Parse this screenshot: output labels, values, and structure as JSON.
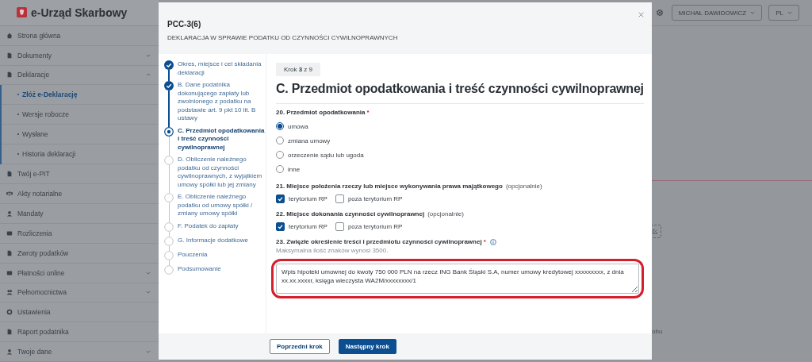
{
  "header": {
    "logo_text": "e-Urząd Skarbowy",
    "user_menu": "MICHAŁ DAWIDOWICZ",
    "language": "PL"
  },
  "sidebar": {
    "items": [
      {
        "label": "Strona główna"
      },
      {
        "label": "Dokumenty",
        "expanded": false
      },
      {
        "label": "Deklaracje",
        "expanded": true,
        "children": [
          {
            "label": "Złóż e-Deklarację",
            "selected": true
          },
          {
            "label": "Wersje robocze",
            "selected": false
          },
          {
            "label": "Wysłane",
            "selected": false
          },
          {
            "label": "Historia deklaracji",
            "selected": false
          }
        ]
      },
      {
        "label": "Twój e-PIT"
      },
      {
        "label": "Akty notarialne"
      },
      {
        "label": "Mandaty"
      },
      {
        "label": "Rozliczenia"
      },
      {
        "label": "Zwroty podatków"
      },
      {
        "label": "Płatności online",
        "expanded": false
      },
      {
        "label": "Pełnomocnictwa",
        "expanded": false
      },
      {
        "label": "Ustawienia"
      },
      {
        "label": "Raport podatnika"
      },
      {
        "label": "Twoje dane",
        "expanded": false
      }
    ]
  },
  "background": {
    "fragment": "obu"
  },
  "modal": {
    "code": "PCC-3(6)",
    "subtitle": "DEKLARACJA W SPRAWIE PODATKU OD CZYNNOŚCI CYWILNOPRAWNYCH",
    "steps": [
      {
        "label": "Okres, miejsce i cel składania deklaracji",
        "done": true,
        "selected": false
      },
      {
        "label": "B. Dane podatnika dokonującego zapłaty lub zwolnionego z podatku na podstawie art. 9 pkt 10 lit. B ustawy",
        "done": true,
        "selected": false
      },
      {
        "label": "C. Przedmiot opodatkowania i treść czynności cywilnoprawnej",
        "done": false,
        "selected": true
      },
      {
        "label": "D. Obliczenie należnego podatku od czynności cywilnoprawnych, z wyjątkiem umowy spółki lub jej zmiany",
        "done": false,
        "selected": false
      },
      {
        "label": "E. Obliczenie należnego podatku od umowy spółki / zmiany umowy spółki",
        "done": false,
        "selected": false
      },
      {
        "label": "F. Podatek do zapłaty",
        "done": false,
        "selected": false
      },
      {
        "label": "G. Informacje dodatkowe",
        "done": false,
        "selected": false
      },
      {
        "label": "Pouczenia",
        "done": false,
        "selected": false
      },
      {
        "label": "Podsumowanie",
        "done": false,
        "selected": false
      }
    ],
    "step_badge": "Krok **3** z 9",
    "title": "C. Przedmiot opodatkowania i treść czynności cywilnoprawnej",
    "questions": [
      {
        "kind": "radio",
        "label": "20. Przedmiot opodatkowania",
        "required_mark": "*",
        "options": [
          {
            "label": "umowa",
            "selected": true
          },
          {
            "label": "zmiana umowy",
            "selected": false
          },
          {
            "label": "orzeczenie sądu lub ugoda",
            "selected": false
          },
          {
            "label": "inne",
            "selected": false
          }
        ]
      },
      {
        "kind": "checkbox",
        "label": "21. Miejsce położenia rzeczy lub miejsce wykonywania prawa majątkowego",
        "note": "(opcjonalnie)",
        "options": [
          {
            "label": "terytorium RP",
            "checked": true
          },
          {
            "label": "poza terytorium RP",
            "checked": false
          }
        ]
      },
      {
        "kind": "checkbox",
        "label": "22. Miejsce dokonania czynności cywilnoprawnej",
        "note": "(opcjonalnie)",
        "options": [
          {
            "label": "terytorium RP",
            "checked": true
          },
          {
            "label": "poza terytorium RP",
            "checked": false
          }
        ]
      },
      {
        "kind": "textarea",
        "label": "23. Zwięzłe określenie treści i przedmiotu czynności cywilnoprawnej",
        "required_mark": "*",
        "info": true,
        "hint": "Maksymalna ilość znaków wynosi 3500.",
        "highlighted": true,
        "value": "Wpis hipoteki umownej do kwoty 750 000 PLN na rzecz ING Bank Śląski S.A, numer umowy kredytowej xxxxxxxxx, z dnia xx.xx.xxxxr, księga wieczysta WA2M/xxxxxxxx/1"
      }
    ],
    "buttons": {
      "back": "Poprzedni krok",
      "next": "Następny krok"
    }
  }
}
